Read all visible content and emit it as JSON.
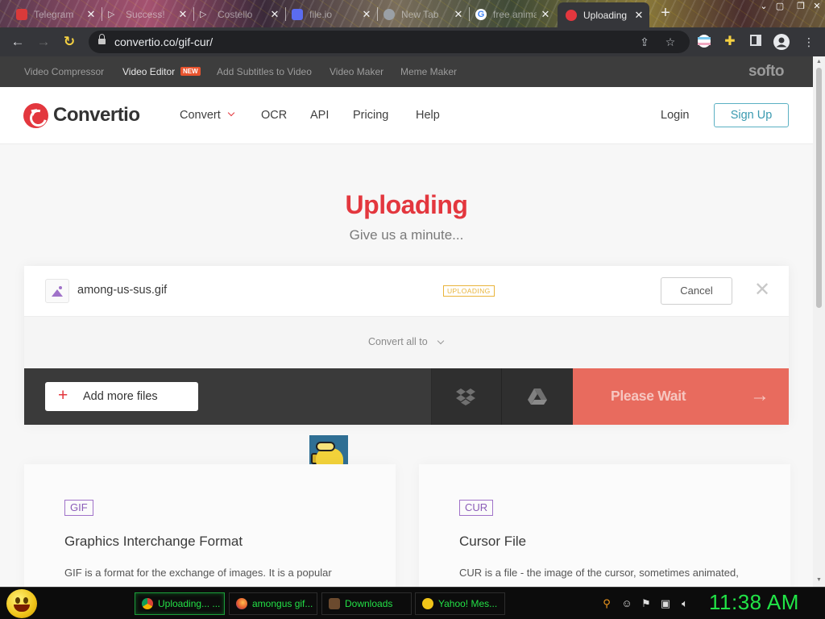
{
  "browser": {
    "tabs": [
      {
        "title": "Telegram"
      },
      {
        "title": "Success!"
      },
      {
        "title": "Costello"
      },
      {
        "title": "file.io"
      },
      {
        "title": "New Tab"
      },
      {
        "title": "free animated"
      },
      {
        "title": "Uploading"
      }
    ],
    "url": "convertio.co/gif-cur/"
  },
  "promo_bar": {
    "links": [
      "Video Compressor",
      "Video Editor",
      "Add Subtitles to Video",
      "Video Maker",
      "Meme Maker"
    ],
    "new_badge": "NEW",
    "brand": "softo"
  },
  "header": {
    "logo": "Convertio",
    "nav": [
      "Convert",
      "OCR",
      "API",
      "Pricing",
      "Help"
    ],
    "login": "Login",
    "signup": "Sign Up"
  },
  "hero": {
    "title": "Uploading",
    "subtitle": "Give us a minute..."
  },
  "uploader": {
    "file_name": "among-us-sus.gif",
    "status": "UPLOADING",
    "cancel": "Cancel",
    "convert_all": "Convert all to",
    "add_files": "Add more files",
    "submit": "Please Wait"
  },
  "formats": [
    {
      "tag": "GIF",
      "title": "Graphics Interchange Format",
      "desc": "GIF is a format for the exchange of images. It is a popular"
    },
    {
      "tag": "CUR",
      "title": "Cursor File",
      "desc": "CUR is a file - the image of the cursor, sometimes animated,"
    }
  ],
  "taskbar": {
    "tasks": [
      "Uploading... ...",
      "amongus gif...",
      "Downloads",
      "Yahoo! Mes..."
    ],
    "clock": "11:38 AM"
  },
  "colors": {
    "accent": "#e3373e",
    "signup": "#3a9ab0",
    "submit_disabled": "#e86b5e",
    "format_tag": "#8b5cb8",
    "status_badge": "#e9b43a",
    "taskbar_text": "#23e046"
  }
}
